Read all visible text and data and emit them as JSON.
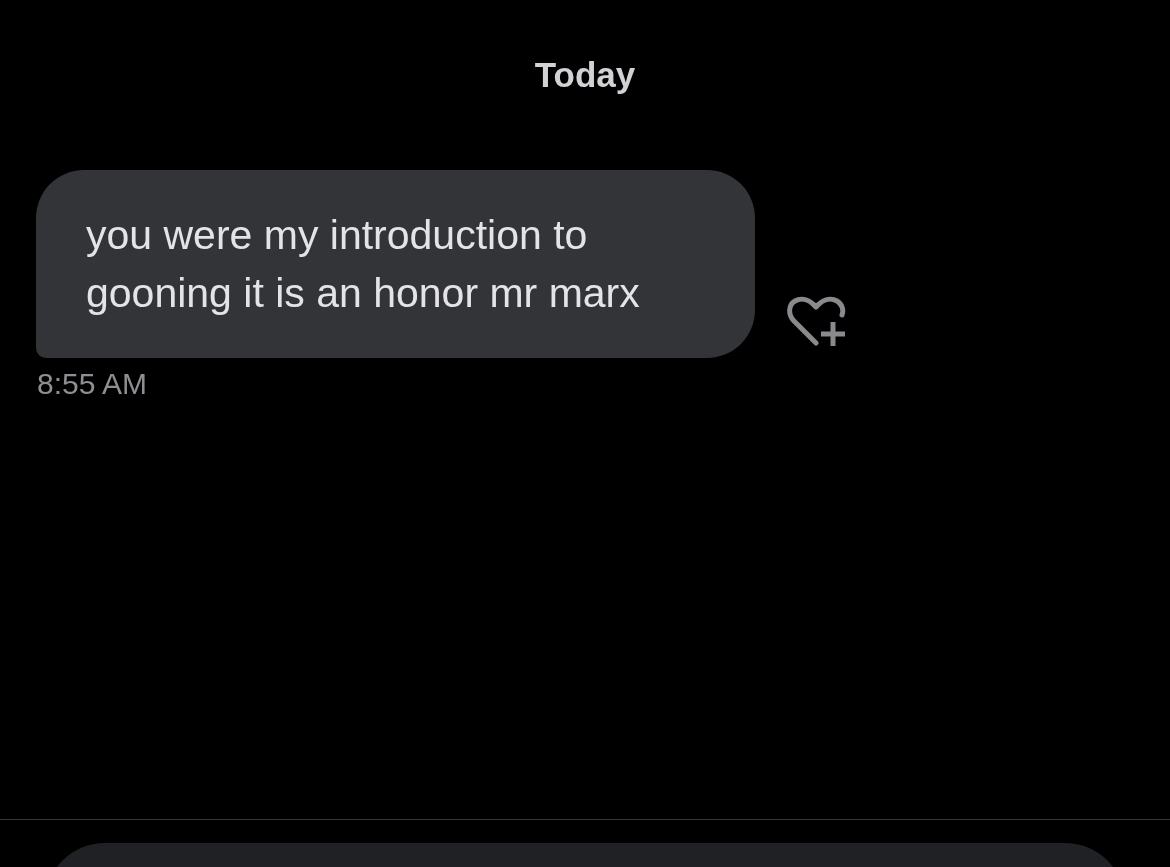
{
  "date_header": "Today",
  "messages": [
    {
      "text": "you were my introduction to gooning it is an honor mr marx",
      "time": "8:55 AM"
    }
  ]
}
